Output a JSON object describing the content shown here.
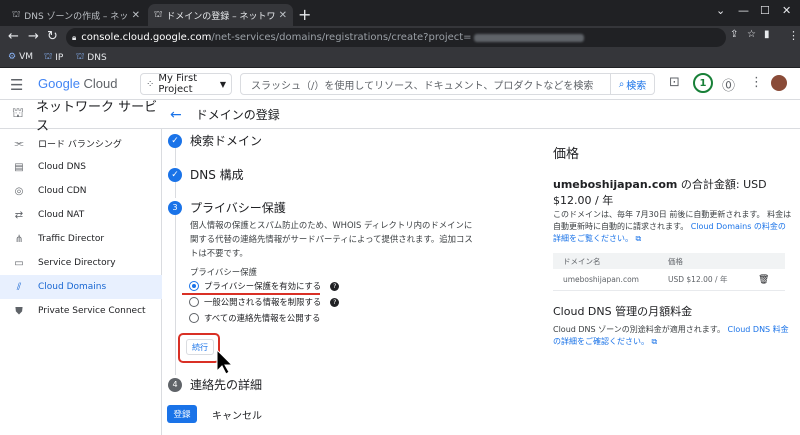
{
  "browser": {
    "tabs": [
      {
        "title": "DNS ゾーンの作成 – ネットワーク サービス"
      },
      {
        "title": "ドメインの登録 – ネットワーク サービス"
      }
    ],
    "url_host": "console.cloud.google.com",
    "url_path": "/net-services/domains/registrations/create?project=",
    "bookmarks": [
      "VM",
      "IP",
      "DNS"
    ]
  },
  "header": {
    "logo_google": "Google",
    "logo_cloud": " Cloud",
    "project": "My First Project",
    "search_placeholder": "スラッシュ（/）を使用してリソース、ドキュメント、プロダクトなどを検索",
    "search_button": "検索",
    "notification_count": "1"
  },
  "sidebar": {
    "title": "ネットワーク サービス",
    "items": [
      {
        "label": "ロード バランシング",
        "icon": "load-balancing-icon"
      },
      {
        "label": "Cloud DNS",
        "icon": "cloud-dns-icon"
      },
      {
        "label": "Cloud CDN",
        "icon": "cloud-cdn-icon"
      },
      {
        "label": "Cloud NAT",
        "icon": "cloud-nat-icon"
      },
      {
        "label": "Traffic Director",
        "icon": "traffic-director-icon"
      },
      {
        "label": "Service Directory",
        "icon": "service-directory-icon"
      },
      {
        "label": "Cloud Domains",
        "icon": "cloud-domains-icon"
      },
      {
        "label": "Private Service Connect",
        "icon": "private-service-connect-icon"
      }
    ]
  },
  "page": {
    "title": "ドメインの登録",
    "steps": [
      {
        "label": "検索ドメイン",
        "state": "done"
      },
      {
        "label": "DNS 構成",
        "state": "done"
      },
      {
        "label": "プライバシー保護",
        "number": "3",
        "state": "current"
      },
      {
        "label": "連絡先の詳細",
        "number": "4",
        "state": "pending"
      }
    ],
    "privacy_desc": "個人情報の保護とスパム防止のため、WHOIS ディレクトリ内のドメインに関する代替の連絡先情報がサードパーティによって提供されます。追加コストは不要です。",
    "privacy_label": "プライバシー保護",
    "options": [
      {
        "label": "プライバシー保護を有効にする",
        "selected": true,
        "help": true
      },
      {
        "label": "一般公開される情報を制限する",
        "selected": false,
        "help": true
      },
      {
        "label": "すべての連絡先情報を公開する",
        "selected": false,
        "help": false
      }
    ],
    "continue_label": "続行",
    "register_label": "登録",
    "cancel_label": "キャンセル"
  },
  "price_panel": {
    "title": "価格",
    "domain": "umeboshijapan.com",
    "total_text": " の合計金額: USD $12.00 / 年",
    "renew_text": "このドメインは、毎年 7月30日 前後に自動更新されます。 料金は自動更新時に自動的に請求されます。",
    "renew_link": "Cloud Domains の料金の詳細をご覧ください。",
    "table_headers": [
      "ドメイン名",
      "価格"
    ],
    "table_row": {
      "domain": "umeboshijapan.com",
      "price": "USD $12.00 / 年"
    },
    "dns_title": "Cloud DNS 管理の月額料金",
    "dns_text": "Cloud DNS ゾーンの別途料金が適用されます。",
    "dns_link": "Cloud DNS 料金の詳細をご確認ください。"
  }
}
